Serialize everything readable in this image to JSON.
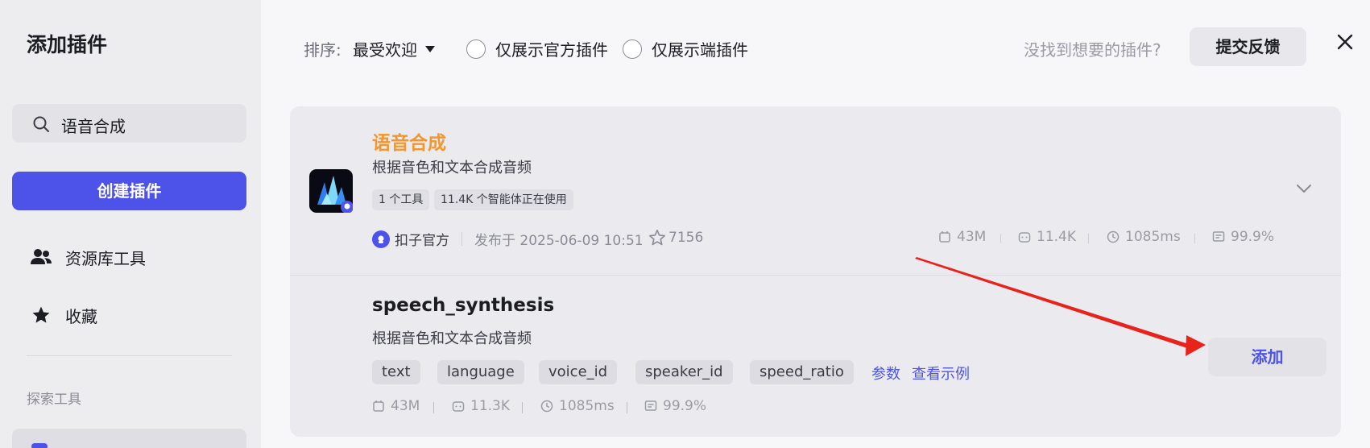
{
  "sidebar": {
    "title": "添加插件",
    "search": {
      "value": "语音合成",
      "icon": "search-icon"
    },
    "create_label": "创建插件",
    "nav": [
      {
        "label": "资源库工具",
        "icon": "users-icon"
      },
      {
        "label": "收藏",
        "icon": "star-icon"
      }
    ],
    "section_label": "探索工具"
  },
  "topbar": {
    "sort_label": "排序:",
    "sort_value": "最受欢迎",
    "filter_official": "仅展示官方插件",
    "filter_device": "仅展示端插件",
    "feedback_hint": "没找到想要的插件?",
    "feedback_button": "提交反馈"
  },
  "plugin": {
    "name": "语音合成",
    "description": "根据音色和文本合成音频",
    "tags": [
      "1 个工具",
      "11.4K 个智能体正在使用"
    ],
    "author": "扣子官方",
    "published": "发布于 2025-06-09 10:51",
    "stars": "7156",
    "stats": [
      {
        "icon": "storage-icon",
        "value": "43M"
      },
      {
        "icon": "bot-icon",
        "value": "11.4K"
      },
      {
        "icon": "clock-icon",
        "value": "1085ms"
      },
      {
        "icon": "success-rate-icon",
        "value": "99.9%"
      }
    ]
  },
  "tool": {
    "name": "speech_synthesis",
    "description": "根据音色和文本合成音频",
    "params": [
      "text",
      "language",
      "voice_id",
      "speaker_id",
      "speed_ratio"
    ],
    "params_link": "参数",
    "example_link": "查看示例",
    "add_label": "添加",
    "stats": [
      {
        "icon": "storage-icon",
        "value": "43M"
      },
      {
        "icon": "bot-icon",
        "value": "11.3K"
      },
      {
        "icon": "clock-icon",
        "value": "1085ms"
      },
      {
        "icon": "success-rate-icon",
        "value": "99.9%"
      }
    ]
  },
  "colors": {
    "accent": "#4d53e8",
    "plugin_name": "#f5962a",
    "annotation_arrow": "#e8231b"
  }
}
